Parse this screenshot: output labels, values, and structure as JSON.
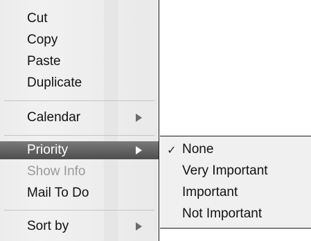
{
  "menu": {
    "items": [
      {
        "label": "Cut",
        "enabled": true
      },
      {
        "label": "Copy",
        "enabled": true
      },
      {
        "label": "Paste",
        "enabled": true
      },
      {
        "label": "Duplicate",
        "enabled": true
      },
      {
        "label": "Calendar",
        "enabled": true,
        "has_submenu": true
      },
      {
        "label": "Priority",
        "enabled": true,
        "has_submenu": true,
        "highlighted": true
      },
      {
        "label": "Show Info",
        "enabled": false
      },
      {
        "label": "Mail To Do",
        "enabled": true
      },
      {
        "label": "Sort by",
        "enabled": true,
        "has_submenu": true
      }
    ]
  },
  "priority_submenu": {
    "checked_index": 0,
    "check_glyph": "✓",
    "items": [
      {
        "label": "None",
        "checked": true
      },
      {
        "label": "Very Important",
        "checked": false
      },
      {
        "label": "Important",
        "checked": false
      },
      {
        "label": "Not Important",
        "checked": false
      }
    ]
  },
  "colors": {
    "highlight_top": "#7a7a7a",
    "highlight_bottom": "#4e4e4e",
    "menu_background": "#ececec",
    "disabled_text": "#9a9a9a"
  },
  "icons": {
    "submenu_arrow": "triangle-right-icon",
    "checkmark": "checkmark-icon"
  }
}
